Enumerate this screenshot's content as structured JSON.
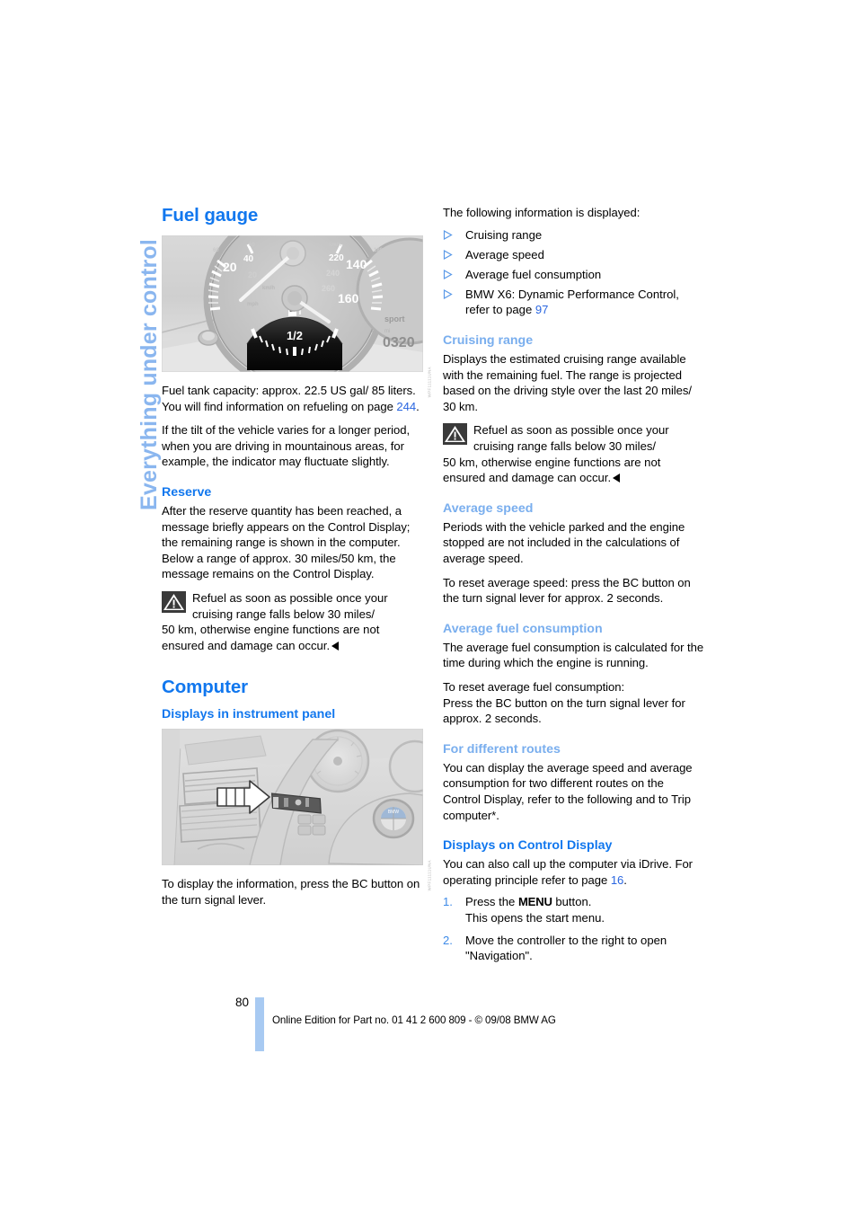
{
  "chapter_tab": "Everything under control",
  "left_column": {
    "section_title": "Fuel gauge",
    "figure_credit": "WPF11111UNA",
    "para_capacity": "Fuel tank capacity: approx. 22.5 US gal/ 85 liters. You will find information on refueling on page ",
    "para_capacity_ref": "244",
    "para_capacity_end": ".",
    "para_tilt": "If the tilt of the vehicle varies for a longer period, when you are driving in mountainous areas, for example, the indicator may fluctuate slightly.",
    "reserve_heading": "Reserve",
    "reserve_body": "After the reserve quantity has been reached, a message briefly appears on the Control Display; the remaining range is shown in the computer. Below a range of approx. 30 miles/50 km, the message remains on the Control Display.",
    "reserve_warning_line1": "Refuel as soon as possible once your",
    "reserve_warning_line2": "cruising range falls below 30 miles/",
    "reserve_warning_rest": "50 km, otherwise engine functions are not ensured and damage can occur.",
    "computer_title": "Computer",
    "displays_panel_heading": "Displays in instrument panel",
    "figure2_credit": "WPF11111UNA",
    "para_display_info": "To display the information, press the BC button on the turn signal lever."
  },
  "right_column": {
    "intro": "The following information is displayed:",
    "bullets": [
      {
        "text": "Cruising range"
      },
      {
        "text": "Average speed"
      },
      {
        "text": "Average fuel consumption"
      },
      {
        "text": "BMW X6: Dynamic Performance Control, refer to page ",
        "ref": "97"
      }
    ],
    "cruising_range_heading": "Cruising range",
    "cruising_range_body": "Displays the estimated cruising range available with the remaining fuel. The range is projected based on the driving style over the last 20 miles/ 30 km.",
    "cruising_warning_line1": "Refuel as soon as possible once your",
    "cruising_warning_line2": "cruising range falls below 30 miles/",
    "cruising_warning_rest": "50 km, otherwise engine functions are not ensured and damage can occur.",
    "average_speed_heading": "Average speed",
    "average_speed_body1": "Periods with the vehicle parked and the engine stopped are not included in the calculations of average speed.",
    "average_speed_body2": "To reset average speed: press the BC button on the turn signal lever for approx. 2 seconds.",
    "average_fuel_heading": "Average fuel consumption",
    "average_fuel_body1": "The average fuel consumption is calculated for the time during which the engine is running.",
    "average_fuel_body2_line1": "To reset average fuel consumption:",
    "average_fuel_body2_line2": "Press the BC button on the turn signal lever for approx. 2 seconds.",
    "different_routes_heading": "For different routes",
    "different_routes_body": "You can display the average speed and average consumption for two different routes on the Control Display, refer to the following and to Trip computer*.",
    "displays_control_heading": "Displays on Control Display",
    "displays_control_body_a": "You can also call up the computer via iDrive. For operating principle refer to page ",
    "displays_control_body_ref": "16",
    "displays_control_body_b": ".",
    "steps": [
      {
        "number": "1.",
        "pre": "Press the ",
        "button": "MENU",
        "post": " button.",
        "line2": "This opens the start menu."
      },
      {
        "number": "2.",
        "pre": "Move the controller to the right to open \"Navigation\".",
        "button": "",
        "post": "",
        "line2": ""
      }
    ]
  },
  "footer": {
    "page_number": "80",
    "imprint": "Online Edition for Part no. 01 41 2 600 809 - © 09/08 BMW AG"
  },
  "colors": {
    "heading_blue": "#1177ee",
    "subheading_light_blue": "#79aeee",
    "tab_blue": "#8ab6ef",
    "xref_blue": "#2a66e0",
    "page_bar": "#a8caf2"
  }
}
